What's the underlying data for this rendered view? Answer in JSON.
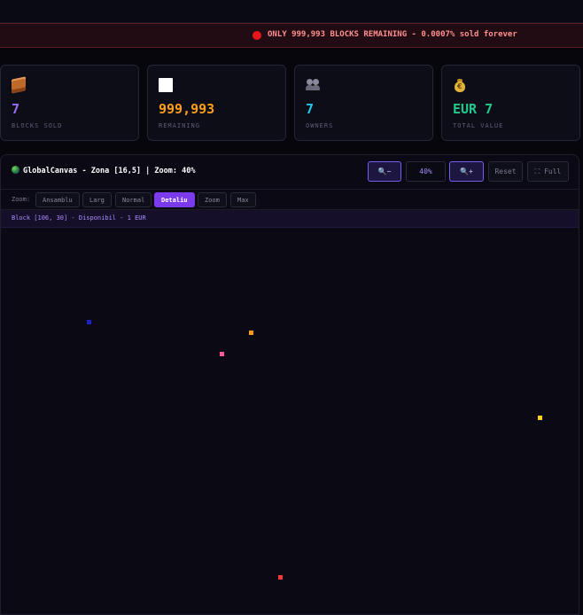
{
  "banner": {
    "text": "ONLY 999,993 BLOCKS REMAINING - 0.0007% sold forever"
  },
  "stats": [
    {
      "icon": "brick-icon",
      "value": "7",
      "label": "BLOCKS SOLD",
      "color": "#9d6bff"
    },
    {
      "icon": "white-square-icon",
      "value": "999,993",
      "label": "REMAINING",
      "color": "#ff9f1a"
    },
    {
      "icon": "people-icon",
      "value": "7",
      "label": "OWNERS",
      "color": "#22c8e8"
    },
    {
      "icon": "money-bag-icon",
      "value": "EUR 7",
      "label": "TOTAL VALUE",
      "color": "#1ec98a"
    }
  ],
  "canvas_panel": {
    "title": "GlobalCanvas - Zona [16,5] | Zoom: 40%",
    "zoom_out_label": "🔍−",
    "zoom_value": "40%",
    "zoom_in_label": "🔍+",
    "reset_label": "Reset",
    "full_label": "⛶ Full"
  },
  "zoom_levels": {
    "label": "Zoom:",
    "options": [
      "Ansamblu",
      "Larg",
      "Normal",
      "Detaliu",
      "Zoom",
      "Max"
    ],
    "active": "Detaliu"
  },
  "hover_info": "Block [106, 30] - Disponibil - 1 EUR",
  "blocks": [
    {
      "color": "#1a22c8"
    },
    {
      "color": "#ff9a1a"
    },
    {
      "color": "#ff5aa0"
    },
    {
      "color": "#ffd21a"
    },
    {
      "color": "#ff3a3a"
    }
  ]
}
